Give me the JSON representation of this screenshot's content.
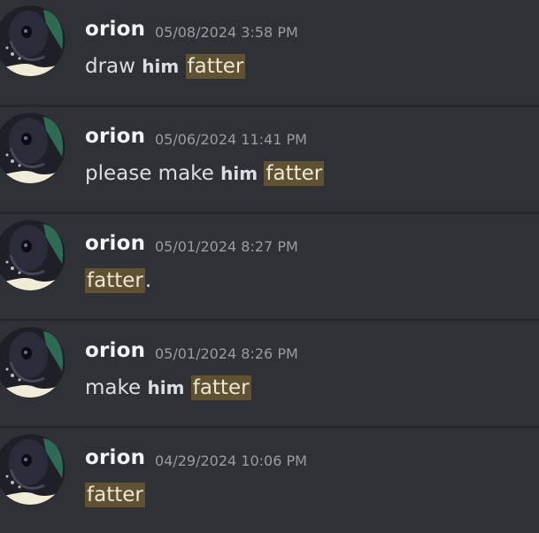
{
  "messages": [
    {
      "username": "orion",
      "timestamp": "05/08/2024 3:58 PM",
      "prefix": "draw ",
      "bold": "him",
      "gap": " ",
      "highlight": "fatter",
      "suffix": ""
    },
    {
      "username": "orion",
      "timestamp": "05/06/2024 11:41 PM",
      "prefix": "please make ",
      "bold": "him",
      "gap": " ",
      "highlight": "fatter",
      "suffix": ""
    },
    {
      "username": "orion",
      "timestamp": "05/01/2024 8:27 PM",
      "prefix": "",
      "bold": "",
      "gap": "",
      "highlight": "fatter",
      "suffix": "."
    },
    {
      "username": "orion",
      "timestamp": "05/01/2024 8:26 PM",
      "prefix": "make ",
      "bold": "him",
      "gap": " ",
      "highlight": "fatter",
      "suffix": ""
    },
    {
      "username": "orion",
      "timestamp": "04/29/2024 10:06 PM",
      "prefix": "",
      "bold": "",
      "gap": "",
      "highlight": "fatter",
      "suffix": ""
    }
  ],
  "colors": {
    "background": "#313338",
    "username": "#f2f3f5",
    "timestamp": "#9a9ca3",
    "message_text": "#dcdee1",
    "search_highlight": "#5f5232"
  },
  "icons": {
    "avatar": "avatar-icon"
  }
}
